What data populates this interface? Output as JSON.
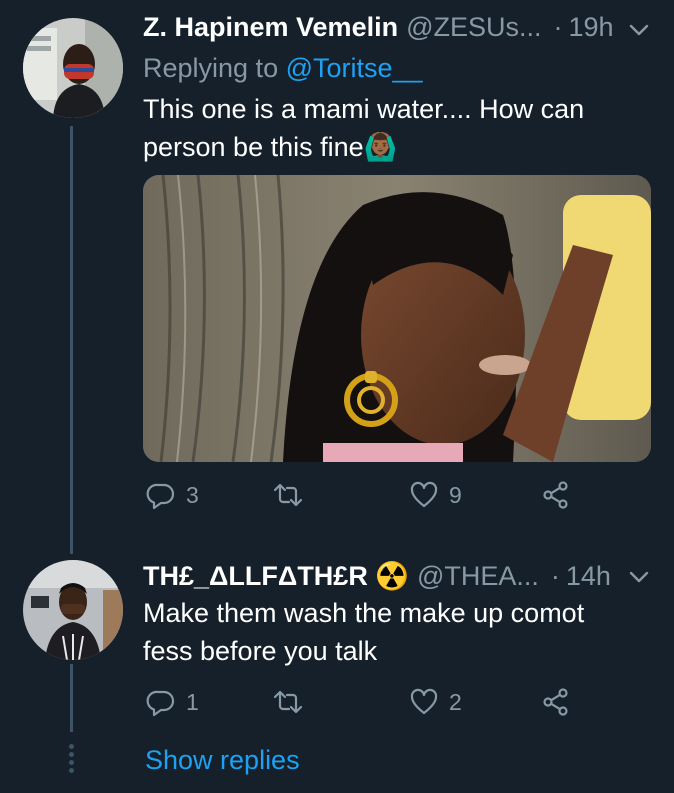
{
  "tweets": [
    {
      "display_name": "Z. Hapinem Vemelin",
      "handle": "@ZESUs...",
      "separator": "·",
      "time": "19h",
      "replying_prefix": "Replying to ",
      "replying_to": "@Toritse__",
      "text_line1": "This one is a mami water.... How can",
      "text_line2": "person be this fine🙆🏾‍♂️",
      "reply_count": "3",
      "retweet_count": "",
      "like_count": "9"
    },
    {
      "display_name": "TH£_ΔLLFΔTH£R ☢️",
      "handle": "@THEA...",
      "separator": "·",
      "time": "14h",
      "text_line1": "Make them wash the make up comot",
      "text_line2": "fess before you talk",
      "reply_count": "1",
      "retweet_count": "",
      "like_count": "2"
    }
  ],
  "show_replies_label": "Show replies",
  "icons": {
    "reply": "reply-icon",
    "retweet": "retweet-icon",
    "like": "heart-icon",
    "share": "share-icon",
    "more": "chevron-down-icon"
  },
  "colors": {
    "background": "#15202b",
    "secondary_text": "#8899a6",
    "link": "#1da1f2",
    "thread_line": "#3d5466"
  }
}
